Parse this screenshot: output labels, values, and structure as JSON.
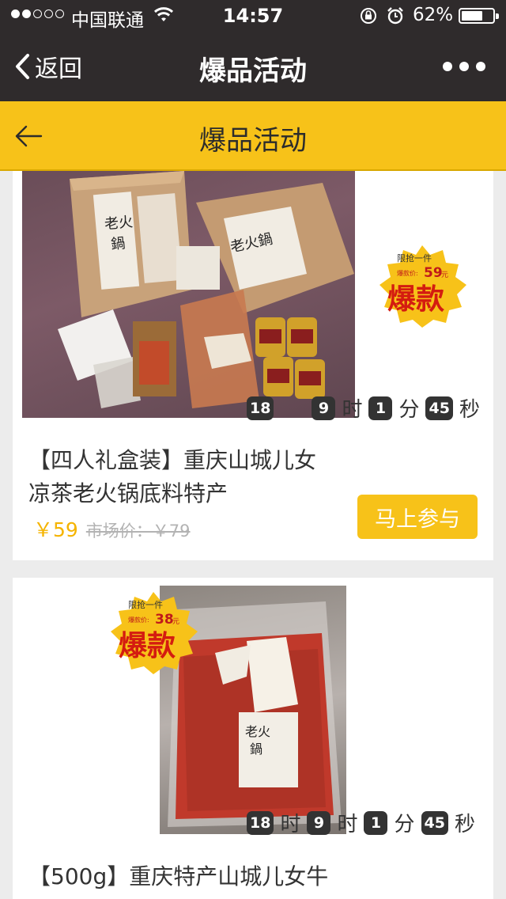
{
  "status_bar": {
    "carrier": "中国联通",
    "time": "14:57",
    "battery": "62%",
    "battery_level": 0.62,
    "signal_bars": 2
  },
  "nav": {
    "back_label": "返回",
    "title": "爆品活动"
  },
  "page": {
    "title": "爆品活动"
  },
  "colors": {
    "accent": "#f7c219",
    "price": "#f5b400",
    "dark_bar": "#2f2b2c"
  },
  "products": [
    {
      "badge_top": "限抢一件",
      "badge_label_prefix": "爆款价:",
      "badge_price": "59",
      "badge_price_unit": "元",
      "badge_big": "爆款",
      "countdown": [
        "18",
        "9",
        "1",
        "45"
      ],
      "countdown_units": [
        "时",
        "分",
        "秒"
      ],
      "title_line1": "【四人礼盒装】重庆山城儿女",
      "title_line2": "凉茶老火锅底料特产",
      "price": "￥59",
      "market_price": "市场价：￥79",
      "button": "马上参与"
    },
    {
      "badge_top": "限抢一件",
      "badge_label_prefix": "爆款价:",
      "badge_price": "38",
      "badge_price_unit": "元",
      "badge_big": "爆款",
      "countdown": [
        "18",
        "9",
        "1",
        "45"
      ],
      "countdown_units": [
        "时",
        "时",
        "分",
        "秒"
      ],
      "title_line1": "【500g】重庆特产山城儿女牛"
    }
  ]
}
